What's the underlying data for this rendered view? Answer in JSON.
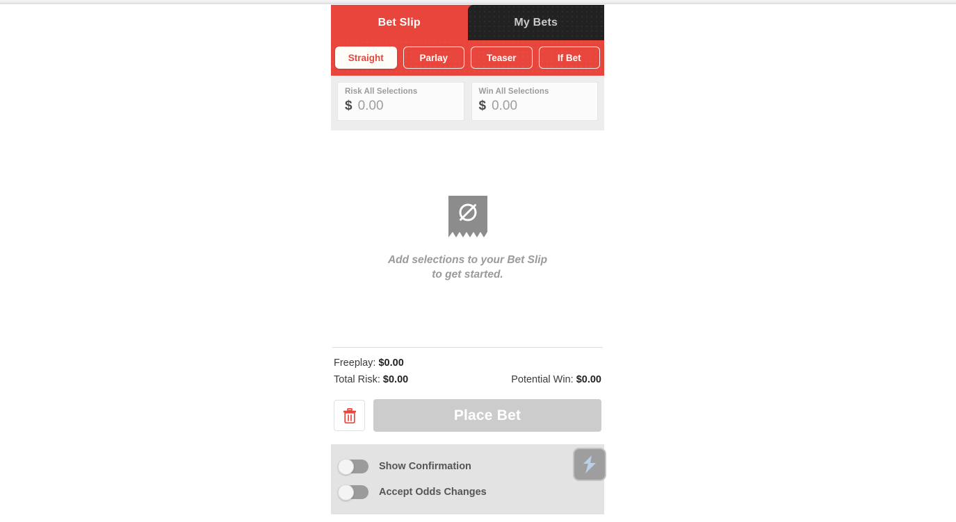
{
  "tabs": [
    {
      "label": "Bet Slip",
      "active": true
    },
    {
      "label": "My Bets",
      "active": false
    }
  ],
  "bet_types": [
    {
      "label": "Straight",
      "active": true
    },
    {
      "label": "Parlay",
      "active": false
    },
    {
      "label": "Teaser",
      "active": false
    },
    {
      "label": "If Bet",
      "active": false
    }
  ],
  "amounts": {
    "risk": {
      "label": "Risk All Selections",
      "currency": "$",
      "value": "0.00"
    },
    "win": {
      "label": "Win All Selections",
      "currency": "$",
      "value": "0.00"
    }
  },
  "empty_state": {
    "icon": "empty-receipt-icon",
    "line1": "Add selections to your Bet Slip",
    "line2": "to get started."
  },
  "totals": {
    "freeplay_label": "Freeplay:",
    "freeplay_value": "$0.00",
    "total_risk_label": "Total Risk:",
    "total_risk_value": "$0.00",
    "potential_win_label": "Potential Win:",
    "potential_win_value": "$0.00"
  },
  "actions": {
    "clear_icon": "trash-icon",
    "place_bet_label": "Place Bet"
  },
  "options": [
    {
      "label": "Show Confirmation",
      "enabled": false
    },
    {
      "label": "Accept Odds Changes",
      "enabled": false
    }
  ],
  "floating_widget": {
    "icon": "lightning-bolt-icon"
  },
  "colors": {
    "accent_red": "#e8463c",
    "tab_dark": "#222222",
    "disabled_gray": "#cccccc",
    "options_bg": "#e3e3e3",
    "strip_bg": "#ededed"
  }
}
